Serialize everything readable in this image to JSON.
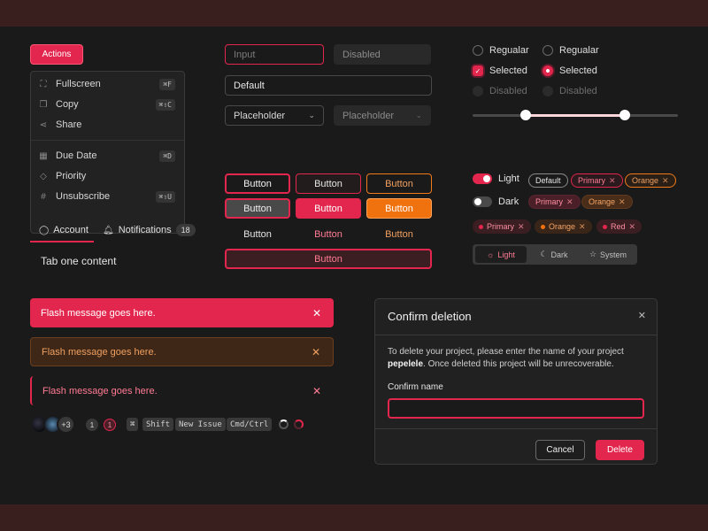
{
  "actions": {
    "button_label": "Actions",
    "menu_items": [
      {
        "icon": "expand-icon",
        "label": "Fullscreen",
        "shortcut": "⌘F"
      },
      {
        "icon": "copy-icon",
        "label": "Copy",
        "shortcut": "⌘⇧C"
      },
      {
        "icon": "share-icon",
        "label": "Share",
        "shortcut": ""
      },
      {
        "icon": "calendar-icon",
        "label": "Due Date",
        "shortcut": "⌘D"
      },
      {
        "icon": "tag-icon",
        "label": "Priority",
        "shortcut": ""
      },
      {
        "icon": "hash-icon",
        "label": "Unsubscribe",
        "shortcut": "⌘⇧U"
      }
    ]
  },
  "tabs": {
    "items": [
      {
        "icon": "user-icon",
        "label": "Account"
      },
      {
        "icon": "bell-icon",
        "label": "Notifications",
        "count": "18"
      }
    ],
    "content": "Tab one content"
  },
  "inputs": {
    "focused_placeholder": "Input",
    "disabled_placeholder": "Disabled",
    "default_value": "Default",
    "select_placeholder": "Placeholder",
    "select_disabled_placeholder": "Placeholder"
  },
  "checkboxes": {
    "regular": "Regualar",
    "selected": "Selected",
    "disabled": "Disabled"
  },
  "radios": {
    "regular": "Regualar",
    "selected": "Selected",
    "disabled": "Disabled"
  },
  "slider": {
    "min_fraction": 0.26,
    "max_fraction": 0.74
  },
  "buttons": {
    "label": "Button",
    "wide_label": "Button"
  },
  "toggles": {
    "on_label": "Light",
    "off_label": "Dark"
  },
  "tags": {
    "row1": [
      "Default",
      "Primary",
      "Orange"
    ],
    "row2": [
      "Primary",
      "Orange"
    ],
    "row3": [
      "Primary",
      "Orange",
      "Red"
    ]
  },
  "segmented": {
    "items": [
      {
        "icon": "sun-icon",
        "label": "Light",
        "active": true
      },
      {
        "icon": "moon-icon",
        "label": "Dark",
        "active": false
      },
      {
        "icon": "star-icon",
        "label": "System",
        "active": false
      }
    ]
  },
  "flash": {
    "message_red": "Flash message goes here.",
    "message_orange": "Flash message goes here.",
    "message_plain": "Flash message goes here."
  },
  "bottom_row": {
    "avatar_overflow": "+3",
    "badge_plain": "1",
    "badge_red": "1",
    "kbd": [
      "⌘",
      "Shift",
      "New Issue",
      "Cmd/Ctrl"
    ]
  },
  "dialog": {
    "title": "Confirm deletion",
    "body_prefix": "To delete your project, please enter the name of your project ",
    "project_name": "pepelele",
    "body_suffix": ". Once deleted this project will be unrecoverable.",
    "field_label": "Confirm name",
    "field_value": "",
    "cancel_label": "Cancel",
    "delete_label": "Delete"
  },
  "colors": {
    "accent": "#e2264d",
    "orange": "#f0720f",
    "background": "#1b1a1b",
    "frame": "#3a1f1f"
  }
}
